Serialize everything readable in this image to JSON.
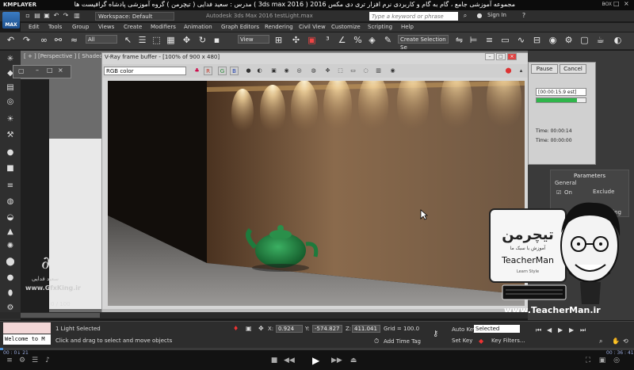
{
  "player": {
    "logo": "KMPLAYER",
    "title": "مجموعه آموزشی جامع ، گام به گام و کاربردی نرم افزار تری دی مکس 2016 ( 3ds max 2016 ) مدرس : سعید فدایی ( تیچرمن ) گروه آموزشی پادشاه گرافیست ها",
    "box_label": "BOX",
    "time_current": "00 : 0↓ 21",
    "time_total": "00 : 36 : 41"
  },
  "max": {
    "logo_label": "MAX",
    "workspace": "Workspace: Default",
    "document": "Autodesk 3ds Max 2016   testLight.max",
    "search_placeholder": "Type a keyword or phrase",
    "sign_in": "Sign In",
    "menus": [
      "Edit",
      "Tools",
      "Group",
      "Views",
      "Create",
      "Modifiers",
      "Animation",
      "Graph Editors",
      "Rendering",
      "Civil View",
      "Customize",
      "Scripting",
      "Help"
    ],
    "filter_dropdown": "All",
    "view_dropdown": "View",
    "selection_set": "Create Selection Se",
    "viewport_label": "[ + ] [Perspective ] [ Shaded ]",
    "frame_counter": "0 / 100"
  },
  "vfb": {
    "title": "V-Ray frame buffer - [100% of 900 x 480]",
    "channel": "RGB color",
    "btn_r": "R",
    "btn_g": "G",
    "btn_b": "B"
  },
  "render_progress": {
    "pause": "Pause",
    "cancel": "Cancel",
    "elapsed": "[00:00:15.9 est]",
    "progress": 0.82,
    "time1": "Time:  00:00:14",
    "time2": "Time:  00:00:00"
  },
  "parameters": {
    "title": "Parameters",
    "general": "General",
    "on": "On",
    "exclude": "Exclude",
    "shading": "hading"
  },
  "status": {
    "selection": "1 Light Selected",
    "prompt": "Click and drag to select and move objects",
    "x_label": "X:",
    "x": "0.924",
    "y_label": "Y:",
    "y": "-574.827",
    "z_label": "Z:",
    "z": "411.041",
    "grid": "Grid = 100.0",
    "add_time_tag": "Add Time Tag",
    "auto_key": "Auto Key",
    "set_key": "Set Key",
    "selected": "Selected",
    "key_filters": "Key Filters...",
    "welcome": "Welcome to M"
  },
  "watermark": {
    "name": "سعید فدایی",
    "url": "www.GfxKing.ir",
    "signature": "Gfx"
  },
  "promo": {
    "brand_fa": "تیچرمن",
    "tagline_fa": "آموزش با سبک ما",
    "brand_en": "TeacherMan",
    "small_en": "Learn Style",
    "url": "www.TeacherMan.ir"
  },
  "colors": {
    "accent": "#2fb54a",
    "vray_red": "#c0392b",
    "teapot": "#2e8f4a",
    "seek": "#4a8fd6"
  }
}
